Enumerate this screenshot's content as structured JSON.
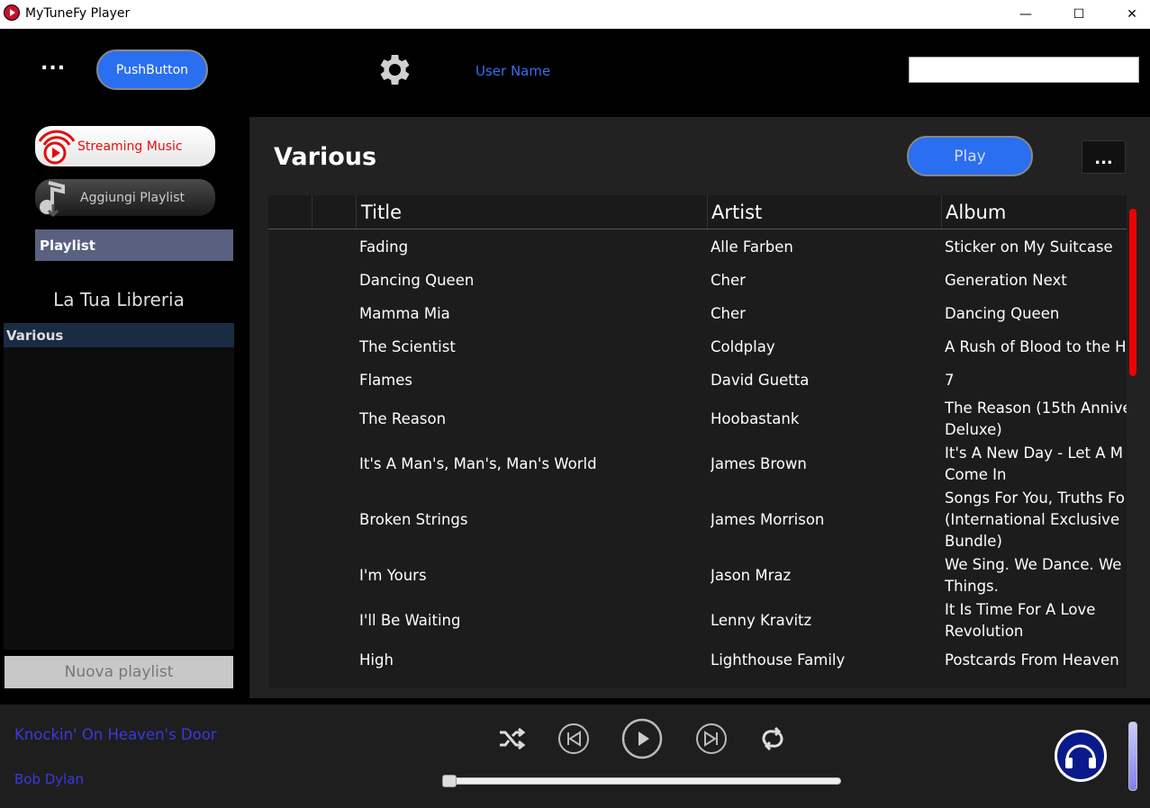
{
  "window": {
    "title": "MyTuneFy Player",
    "minimize_glyph": "—",
    "maximize_glyph": "☐",
    "close_glyph": "✕"
  },
  "header": {
    "menu_label": "...",
    "push_button_label": "PushButton",
    "user_name": "User Name",
    "settings_icon": "gear-icon",
    "search_value": ""
  },
  "sidebar": {
    "streaming_label": "Streaming Music",
    "add_playlist_label": "Aggiungi Playlist",
    "playlist_header": "Playlist",
    "library_title": "La Tua Libreria",
    "library_items": [
      "Various"
    ],
    "new_playlist_label": "Nuova playlist"
  },
  "main": {
    "title": "Various",
    "play_label": "Play",
    "more_label": "...",
    "columns": [
      "Title",
      "Artist",
      "Album"
    ],
    "rows": [
      {
        "title": "Fading",
        "artist": "Alle Farben",
        "album": [
          "Sticker on My Suitcase"
        ]
      },
      {
        "title": "Dancing Queen",
        "artist": "Cher",
        "album": [
          "Generation Next"
        ]
      },
      {
        "title": "Mamma Mia",
        "artist": "Cher",
        "album": [
          "Dancing Queen"
        ]
      },
      {
        "title": "The Scientist",
        "artist": "Coldplay",
        "album": [
          "A Rush of Blood to the H"
        ]
      },
      {
        "title": "Flames",
        "artist": "David Guetta",
        "album": [
          "7"
        ]
      },
      {
        "title": "The Reason",
        "artist": "Hoobastank",
        "album": [
          "The Reason (15th Anniver",
          "Deluxe)"
        ]
      },
      {
        "title": "It's A Man's, Man's, Man's World",
        "artist": "James Brown",
        "album": [
          "It's A New Day - Let A M",
          "Come In"
        ]
      },
      {
        "title": "Broken Strings",
        "artist": "James Morrison",
        "album": [
          "Songs For You, Truths Fo",
          "(International Exclusive",
          "Bundle)"
        ]
      },
      {
        "title": "I'm Yours",
        "artist": "Jason Mraz",
        "album": [
          "We Sing. We Dance. We S",
          "Things."
        ]
      },
      {
        "title": "I'll Be Waiting",
        "artist": "Lenny Kravitz",
        "album": [
          "It Is Time For A Love",
          "Revolution"
        ]
      },
      {
        "title": "High",
        "artist": "Lighthouse Family",
        "album": [
          "Postcards From Heaven"
        ]
      }
    ]
  },
  "player": {
    "now_playing_title": "Knockin' On Heaven's Door",
    "now_playing_artist": "Bob Dylan",
    "progress": 0.0,
    "controls": [
      "shuffle-icon",
      "previous-icon",
      "play-icon",
      "next-icon",
      "repeat-icon"
    ],
    "accent_color": "#2a6ff0"
  }
}
